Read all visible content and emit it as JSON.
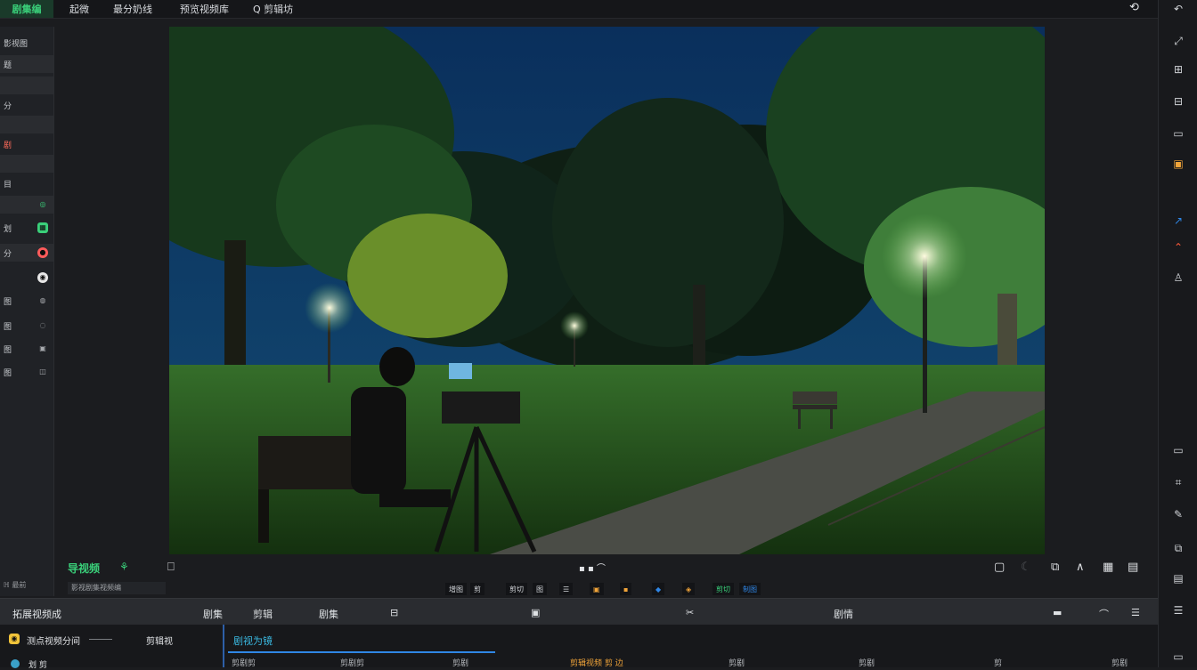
{
  "topbar": {
    "app_tag": "剧集编",
    "menu": [
      "起微",
      "最分奶线",
      "预览视频库",
      "Q 剪辑坊"
    ]
  },
  "left_panel": {
    "rows": [
      {
        "label": "影视图",
        "badge": ""
      },
      {
        "label": "题",
        "badge": ""
      },
      {
        "label": "",
        "badge": ""
      },
      {
        "label": "分",
        "badge": ""
      },
      {
        "label": "剧",
        "badge": ""
      },
      {
        "label": "",
        "badge": ""
      },
      {
        "label": "目",
        "badge": ""
      },
      {
        "label": "",
        "badge": "◎"
      },
      {
        "label": "划",
        "badge": "▦"
      },
      {
        "label": "分",
        "badge": "●"
      },
      {
        "label": "",
        "badge": "◉"
      },
      {
        "label": "图",
        "badge": "◍"
      },
      {
        "label": "图",
        "badge": "◌"
      },
      {
        "label": "图",
        "badge": "▣"
      },
      {
        "label": "图",
        "badge": "◫"
      }
    ],
    "footer": "ℍ 最前"
  },
  "under_preview": {
    "left_label": "导视频",
    "left_sub": "影视剧集视频编",
    "chips": [
      "增图",
      "剪",
      "剪切",
      "图",
      "☰",
      "▣",
      "▪",
      "◆",
      "◈",
      "剪切",
      "制图"
    ]
  },
  "bottom_bar": {
    "left_title": "拓展视频成",
    "tab_1": "剧集",
    "tab_2": "剪辑",
    "tab_3": "剧集",
    "tab_4": "剧情"
  },
  "timeline": {
    "track_1": "测点视频分间",
    "track_2": "剪辑视",
    "track_3": "划 剪",
    "header": "剧视为镜",
    "ruler": [
      "剪剧剪",
      "剪剧剪",
      "剪剧",
      "剪辑视频 剪 边",
      "剪剧",
      "剪剧",
      "剪",
      "剪剧"
    ]
  },
  "colors": {
    "accent_green": "#3ad07a",
    "accent_orange": "#f2a53a",
    "accent_blue": "#2f86e5",
    "panel": "#202226",
    "background": "#1b1c1f"
  }
}
